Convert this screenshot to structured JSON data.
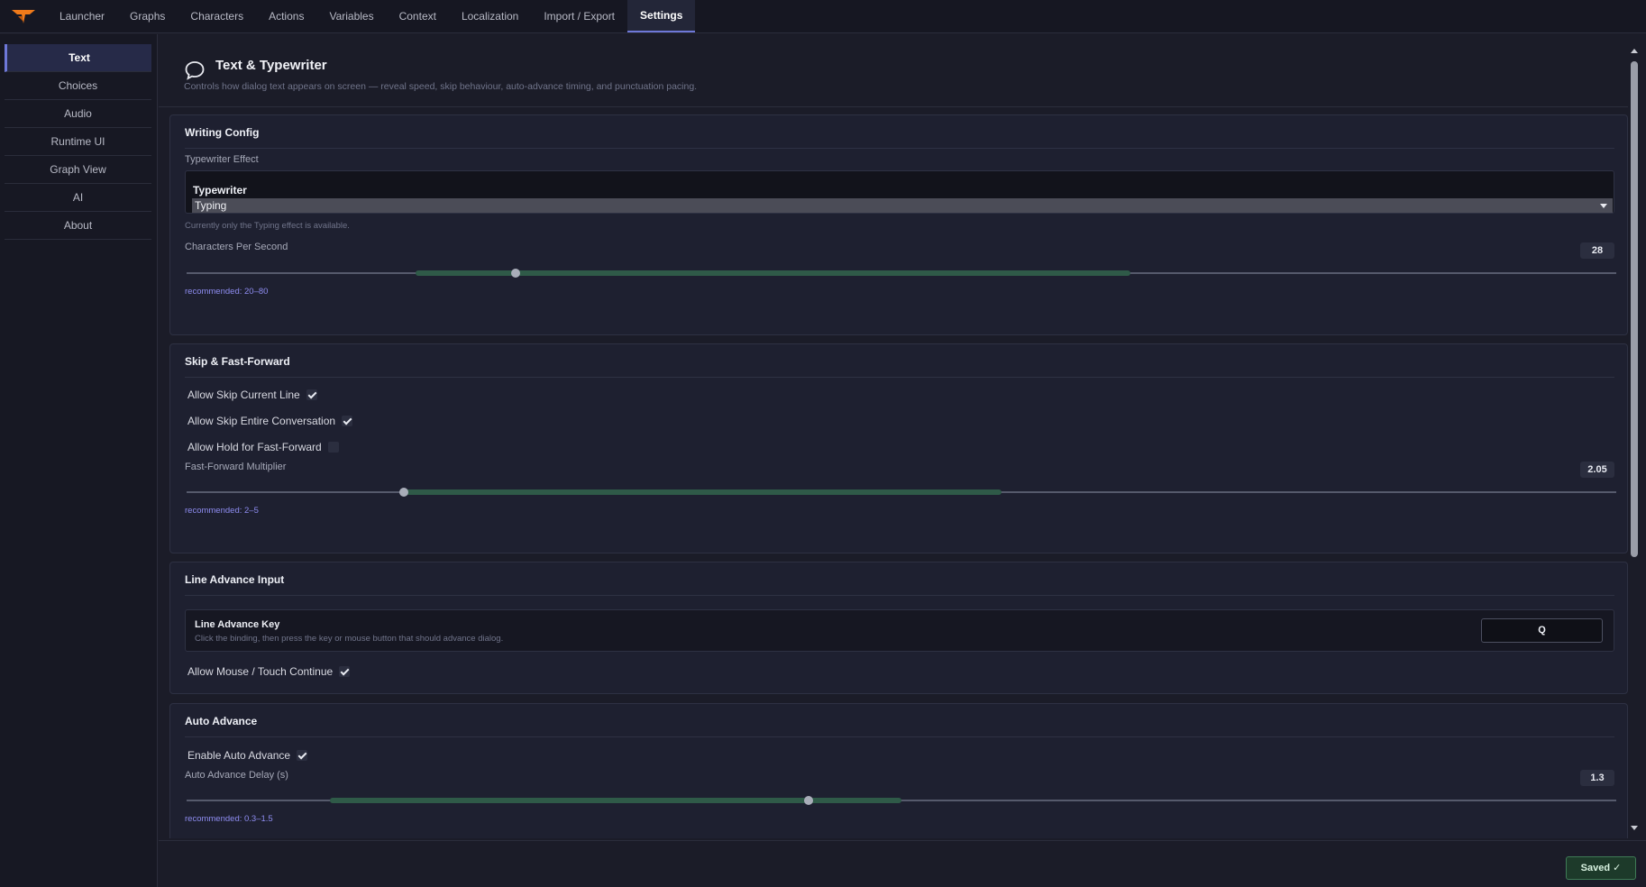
{
  "nav": {
    "tabs": [
      {
        "label": "Launcher"
      },
      {
        "label": "Graphs"
      },
      {
        "label": "Characters"
      },
      {
        "label": "Actions"
      },
      {
        "label": "Variables"
      },
      {
        "label": "Context"
      },
      {
        "label": "Localization"
      },
      {
        "label": "Import / Export"
      },
      {
        "label": "Settings"
      }
    ],
    "active_tab": "Settings",
    "logo_icon": "logo-icon",
    "logo_color": "#f07a1a"
  },
  "sidebar": {
    "items": [
      {
        "label": "Text"
      },
      {
        "label": "Choices"
      },
      {
        "label": "Audio"
      },
      {
        "label": "Runtime UI"
      },
      {
        "label": "Graph View"
      },
      {
        "label": "AI"
      },
      {
        "label": "About"
      }
    ],
    "active_item": "Text"
  },
  "header": {
    "icon": "speech-bubble-icon",
    "title": "Text & Typewriter",
    "description": "Controls how dialog text appears on screen — reveal speed, skip behaviour, auto-advance timing, and punctuation pacing."
  },
  "writing_config": {
    "title": "Writing Config",
    "typewriter_effect_label": "Typewriter Effect",
    "select_label": "Typewriter",
    "select_value": "Typing",
    "hint": "Currently only the Typing effect is available.",
    "cps_label": "Characters Per Second",
    "cps_value": "28",
    "cps_slider": {
      "min": 0,
      "max": 100,
      "value": 23,
      "rec_min": 16,
      "rec_max": 66
    },
    "recommended": "recommended: 20–80"
  },
  "skip": {
    "title": "Skip & Fast-Forward",
    "options": [
      {
        "label": "Allow Skip Current Line",
        "checked": true
      },
      {
        "label": "Allow Skip Entire Conversation",
        "checked": true
      },
      {
        "label": "Allow Hold for Fast-Forward",
        "checked": false
      }
    ],
    "ff_label": "Fast-Forward Multiplier",
    "ff_value": "2.05",
    "ff_slider": {
      "min": 0,
      "max": 100,
      "value": 15.2,
      "rec_min": 15,
      "rec_max": 57
    },
    "recommended": "recommended: 2–5"
  },
  "line_advance": {
    "title": "Line Advance Input",
    "key_title": "Line Advance Key",
    "key_desc": "Click the binding, then press the key or mouse button that should advance dialog.",
    "key_value": "Q",
    "mouse_option": {
      "label": "Allow Mouse / Touch Continue",
      "checked": true
    }
  },
  "auto_advance": {
    "title": "Auto Advance",
    "enable_option": {
      "label": "Enable Auto Advance",
      "checked": true
    },
    "delay_label": "Auto Advance Delay (s)",
    "delay_value": "1.3",
    "delay_slider": {
      "min": 0,
      "max": 100,
      "value": 43.5,
      "rec_min": 10,
      "rec_max": 50
    },
    "recommended": "recommended: 0.3–1.5"
  },
  "footer": {
    "saved_label": "Saved ✓",
    "saved_color": "#3f7b56"
  }
}
